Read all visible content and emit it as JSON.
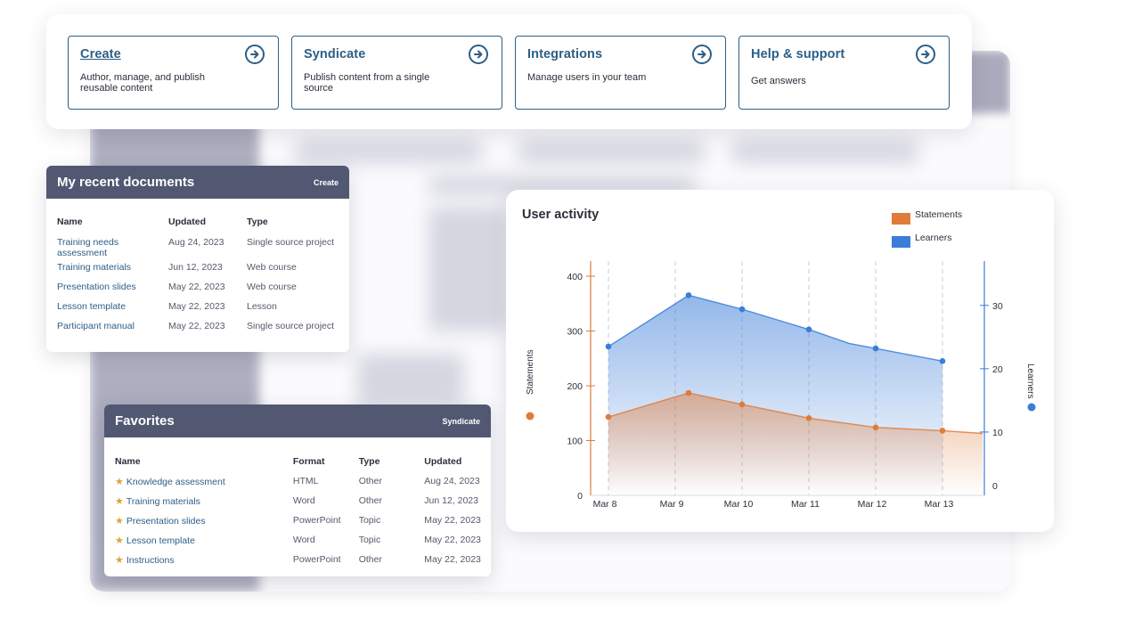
{
  "nav_cards": [
    {
      "title": "Create",
      "description": "Author, manage, and publish reusable content",
      "underline": true
    },
    {
      "title": "Syndicate",
      "description": "Publish content from a single source",
      "underline": false
    },
    {
      "title": "Integrations",
      "description": "Manage users in your team",
      "underline": false
    },
    {
      "title": "Help & support",
      "description": "Get answers",
      "underline": false
    }
  ],
  "recent_documents": {
    "title": "My recent documents",
    "action": "Create",
    "columns": [
      "Name",
      "Updated",
      "Type"
    ],
    "rows": [
      {
        "name": "Training needs assessment",
        "updated": "Aug 24, 2023",
        "type": "Single source project"
      },
      {
        "name": "Training materials",
        "updated": "Jun 12, 2023",
        "type": "Web course"
      },
      {
        "name": "Presentation slides",
        "updated": "May 22, 2023",
        "type": "Web course"
      },
      {
        "name": "Lesson template",
        "updated": "May 22, 2023",
        "type": "Lesson"
      },
      {
        "name": "Participant manual",
        "updated": "May 22, 2023",
        "type": "Single source project"
      }
    ]
  },
  "favorites": {
    "title": "Favorites",
    "action": "Syndicate",
    "columns": [
      "Name",
      "Format",
      "Type",
      "Updated"
    ],
    "rows": [
      {
        "name": "Knowledge assessment",
        "format": "HTML",
        "type": "Other",
        "updated": "Aug 24, 2023"
      },
      {
        "name": "Training materials",
        "format": "Word",
        "type": "Other",
        "updated": "Jun 12, 2023"
      },
      {
        "name": "Presentation slides",
        "format": "PowerPoint",
        "type": "Topic",
        "updated": "May 22, 2023"
      },
      {
        "name": "Lesson template",
        "format": "Word",
        "type": "Topic",
        "updated": "May 22, 2023"
      },
      {
        "name": "Instructions",
        "format": "PowerPoint",
        "type": "Other",
        "updated": "May 22, 2023"
      }
    ]
  },
  "colors": {
    "accent": "#2d5e86",
    "header": "#525872",
    "statements": "#e07b39",
    "learners": "#3b7dd8",
    "star": "#d9a53c"
  },
  "icons": {
    "nav_arrow": "arrow-right-circle-icon",
    "favorite": "star-icon"
  },
  "chart_data": {
    "type": "area",
    "title": "User activity",
    "categories": [
      "Mar 8",
      "Mar 9",
      "Mar 10",
      "Mar 11",
      "Mar 12",
      "Mar 13"
    ],
    "left_axis": {
      "label": "Statements",
      "ticks": [
        0,
        100,
        200,
        300,
        400
      ],
      "range": [
        0,
        400
      ]
    },
    "right_axis": {
      "label": "Learners",
      "ticks": [
        0,
        10,
        20,
        30
      ],
      "range": [
        0,
        37
      ]
    },
    "legend_position": "top-right",
    "grid": "vertical-dashed",
    "series": [
      {
        "name": "Statements",
        "axis": "left",
        "color": "#e07b39",
        "x": [
          0,
          1.2,
          2,
          3,
          4,
          5,
          5.6
        ],
        "y": [
          143,
          187,
          166,
          141,
          124,
          118,
          113
        ],
        "markers": [
          true,
          true,
          true,
          true,
          true,
          true,
          false
        ]
      },
      {
        "name": "Learners",
        "axis": "right",
        "color": "#3b7dd8",
        "x": [
          0,
          1.2,
          2,
          3,
          3.6,
          4,
          5
        ],
        "y": [
          23.5,
          31.6,
          29.4,
          26.2,
          24,
          23.2,
          21.2
        ],
        "markers": [
          true,
          true,
          true,
          true,
          false,
          true,
          true
        ]
      }
    ]
  }
}
